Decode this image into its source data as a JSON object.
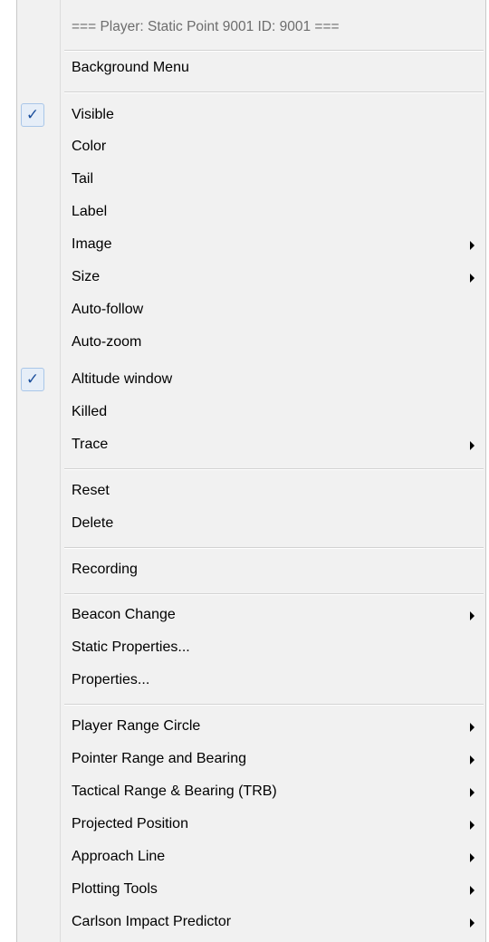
{
  "menu": {
    "header": "=== Player: Static Point 9001  ID: 9001 ===",
    "background_menu": "Background Menu",
    "items": {
      "visible": {
        "label": "Visible",
        "checked": true
      },
      "color": {
        "label": "Color"
      },
      "tail": {
        "label": "Tail"
      },
      "label": {
        "label": "Label"
      },
      "image": {
        "label": "Image",
        "submenu": true
      },
      "size": {
        "label": "Size",
        "submenu": true
      },
      "auto_follow": {
        "label": "Auto-follow"
      },
      "auto_zoom": {
        "label": "Auto-zoom"
      },
      "altitude_window": {
        "label": "Altitude window",
        "checked": true
      },
      "killed": {
        "label": "Killed"
      },
      "trace": {
        "label": "Trace",
        "submenu": true
      },
      "reset": {
        "label": "Reset"
      },
      "delete": {
        "label": "Delete"
      },
      "recording": {
        "label": "Recording"
      },
      "beacon_change": {
        "label": "Beacon Change",
        "submenu": true
      },
      "static_properties": {
        "label": "Static Properties..."
      },
      "properties": {
        "label": "Properties..."
      },
      "player_range_circle": {
        "label": "Player Range Circle",
        "submenu": true
      },
      "pointer_range_bearing": {
        "label": "Pointer Range and Bearing",
        "submenu": true
      },
      "tactical_range_bearing": {
        "label": "Tactical Range & Bearing (TRB)",
        "submenu": true
      },
      "projected_position": {
        "label": "Projected Position",
        "submenu": true
      },
      "approach_line": {
        "label": "Approach Line",
        "submenu": true
      },
      "plotting_tools": {
        "label": "Plotting Tools",
        "submenu": true
      },
      "carlson_impact_predictor": {
        "label": "Carlson Impact Predictor",
        "submenu": true
      }
    },
    "check_glyph": "✓",
    "colors": {
      "check": "#1c4f9c",
      "background": "#f1f1f1",
      "header_text": "#6d6d6d"
    }
  }
}
